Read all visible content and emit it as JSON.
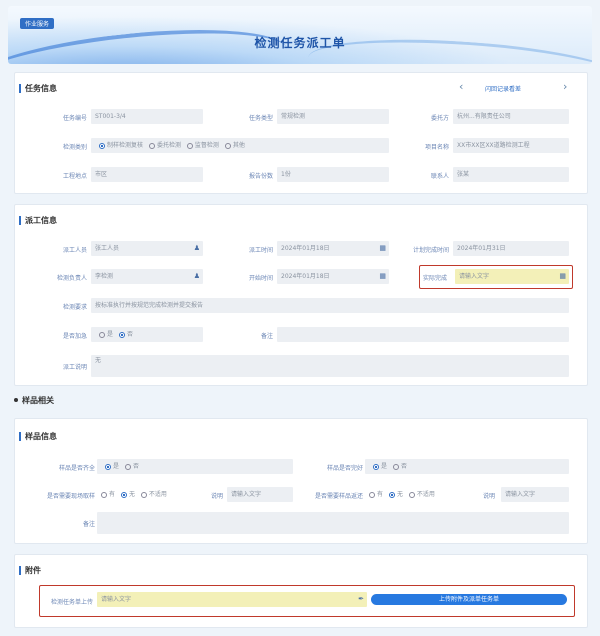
{
  "header": {
    "tag": "作业服务",
    "title": "检测任务派工单"
  },
  "task_info": {
    "title": "任务信息",
    "pager": "闪回记录看差",
    "row1": [
      {
        "label": "任务编号",
        "value": "ST001-3/4"
      },
      {
        "label": "任务类型",
        "value": "常规检测"
      },
      {
        "label": "委托方",
        "value": "杭州...有限责任公司"
      }
    ],
    "row2": {
      "label": "检测类别",
      "options": [
        "制样检测复核",
        "委托检测",
        "监督检测",
        "其他"
      ],
      "selected": 0,
      "label2": "项目名称",
      "value2": "XX市XX区XX道路检测工程"
    },
    "row3": [
      {
        "label": "工程地点",
        "value": "市区"
      },
      {
        "label": "报告份数",
        "value": "1份"
      },
      {
        "label": "联系人",
        "value": "张某"
      }
    ]
  },
  "dispatch_info": {
    "title": "派工信息",
    "row1": [
      {
        "label": "派工人员",
        "value": "张工人员",
        "icon": "user-icon"
      },
      {
        "label": "派工时间",
        "value": "2024年01月18日",
        "icon": "calendar-icon"
      },
      {
        "label": "计划完成时间",
        "value": "2024年01月31日"
      }
    ],
    "row2": [
      {
        "label": "检测负责人",
        "value": "李检测",
        "icon": "user-icon"
      },
      {
        "label": "开始时间",
        "value": "2024年01月18日",
        "icon": "calendar-icon"
      },
      {
        "label": "实际完成",
        "placeholder": "请输入文字",
        "icon": "calendar-icon"
      }
    ],
    "requirements": {
      "label": "检测要求",
      "value": "按标准执行并按规范完成检测并提交报告"
    },
    "row4": {
      "label": "是否加急",
      "options": [
        "是",
        "否"
      ],
      "selected": 1,
      "label2": "备注"
    },
    "note": {
      "label": "派工说明",
      "value": "无"
    }
  },
  "sample_section": {
    "title": "样品相关"
  },
  "sample_info": {
    "title": "样品信息",
    "row1": {
      "label": "样品是否齐全",
      "options": [
        "是",
        "否"
      ],
      "selected": 0,
      "label2": "样品是否完好",
      "options2": [
        "是",
        "否"
      ],
      "selected2": 0
    },
    "row2": {
      "label": "是否需要现场取样",
      "options": [
        "有",
        "无",
        "不适用"
      ],
      "selected": 1,
      "detail_label": "说明",
      "detail_placeholder": "请输入文字",
      "label2": "是否需要样品返还",
      "options2": [
        "有",
        "无",
        "不适用"
      ],
      "selected2": 1,
      "detail_label2": "说明",
      "detail_placeholder2": "请输入文字"
    },
    "remark": {
      "label": "备注"
    }
  },
  "attachment": {
    "title": "附件",
    "label": "检测任务单上传",
    "placeholder": "请输入文字",
    "button": "上传附件及派单任务单"
  }
}
